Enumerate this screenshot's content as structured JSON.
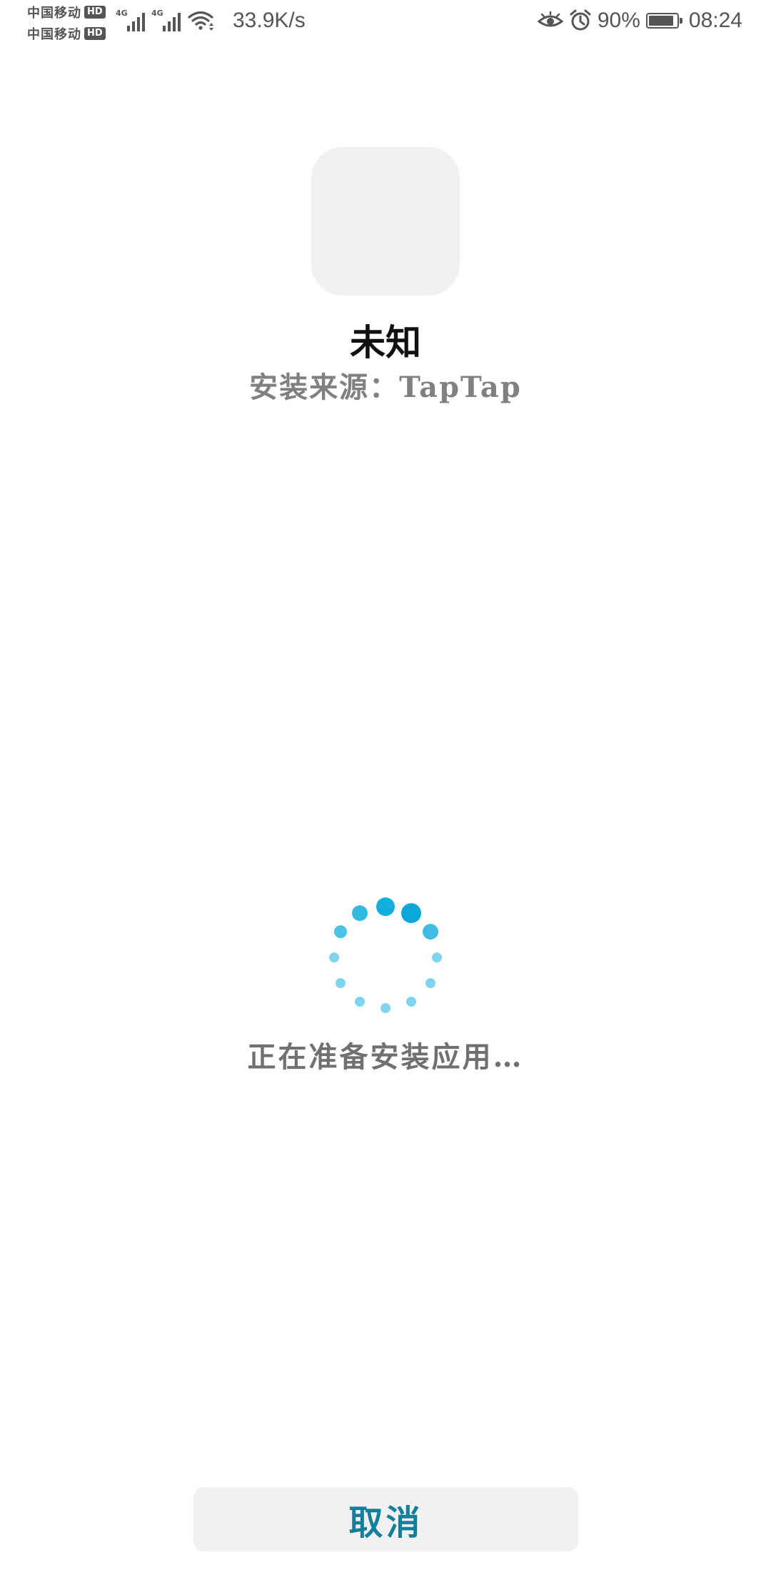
{
  "status_bar": {
    "carriers": [
      {
        "name": "中国移动",
        "badge": "HD",
        "network": "4G"
      },
      {
        "name": "中国移动",
        "badge": "HD",
        "network": "4G"
      }
    ],
    "net_speed": "33.9K/s",
    "battery_percent": "90%",
    "battery_level": 0.9,
    "time": "08:24",
    "icons": [
      "eye-comfort-icon",
      "alarm-icon",
      "wifi-icon",
      "battery-icon"
    ]
  },
  "app": {
    "name": "未知",
    "install_source": "安装来源：TapTap"
  },
  "progress": {
    "text": "正在准备安装应用…"
  },
  "actions": {
    "cancel_label": "取消"
  },
  "colors": {
    "accent": "#147f9a",
    "spinner": "#1aaee0",
    "icon_placeholder": "#f1f1f1",
    "button_bg": "#f1f1f1"
  }
}
